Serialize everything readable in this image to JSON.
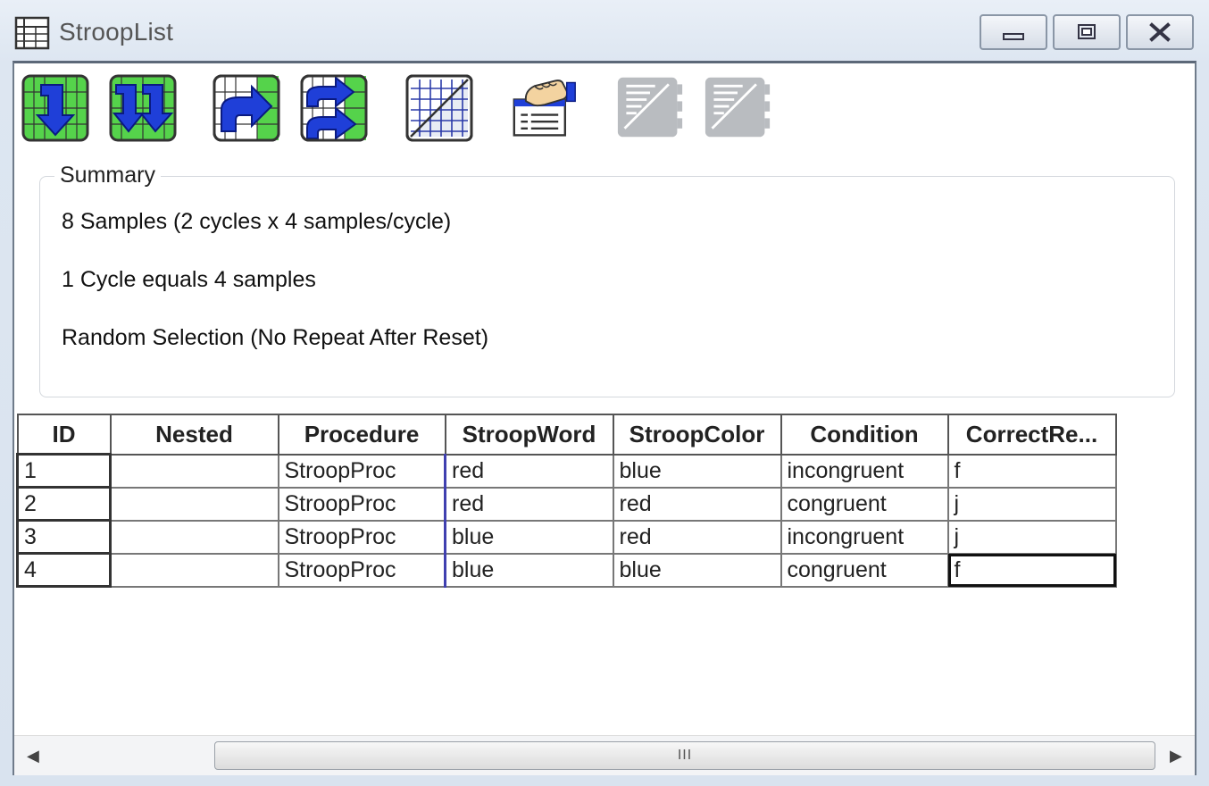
{
  "window": {
    "title": "StroopList"
  },
  "summary": {
    "legend": "Summary",
    "lines": [
      "8 Samples (2 cycles x 4 samples/cycle)",
      "1 Cycle equals 4 samples",
      "Random Selection  (No Repeat After Reset)"
    ]
  },
  "grid": {
    "headers": [
      "ID",
      "Nested",
      "Procedure",
      "StroopWord",
      "StroopColor",
      "Condition",
      "CorrectRe..."
    ],
    "rows": [
      [
        "1",
        "",
        "StroopProc",
        "red",
        "blue",
        "incongruent",
        "f"
      ],
      [
        "2",
        "",
        "StroopProc",
        "red",
        "red",
        "congruent",
        "j"
      ],
      [
        "3",
        "",
        "StroopProc",
        "blue",
        "red",
        "incongruent",
        "j"
      ],
      [
        "4",
        "",
        "StroopProc",
        "blue",
        "blue",
        "congruent",
        "f"
      ]
    ]
  },
  "scrollbar": {
    "grip": "III"
  },
  "colors": {
    "arrow_blue": "#1f3fd8",
    "cell_green": "#55d34b"
  }
}
